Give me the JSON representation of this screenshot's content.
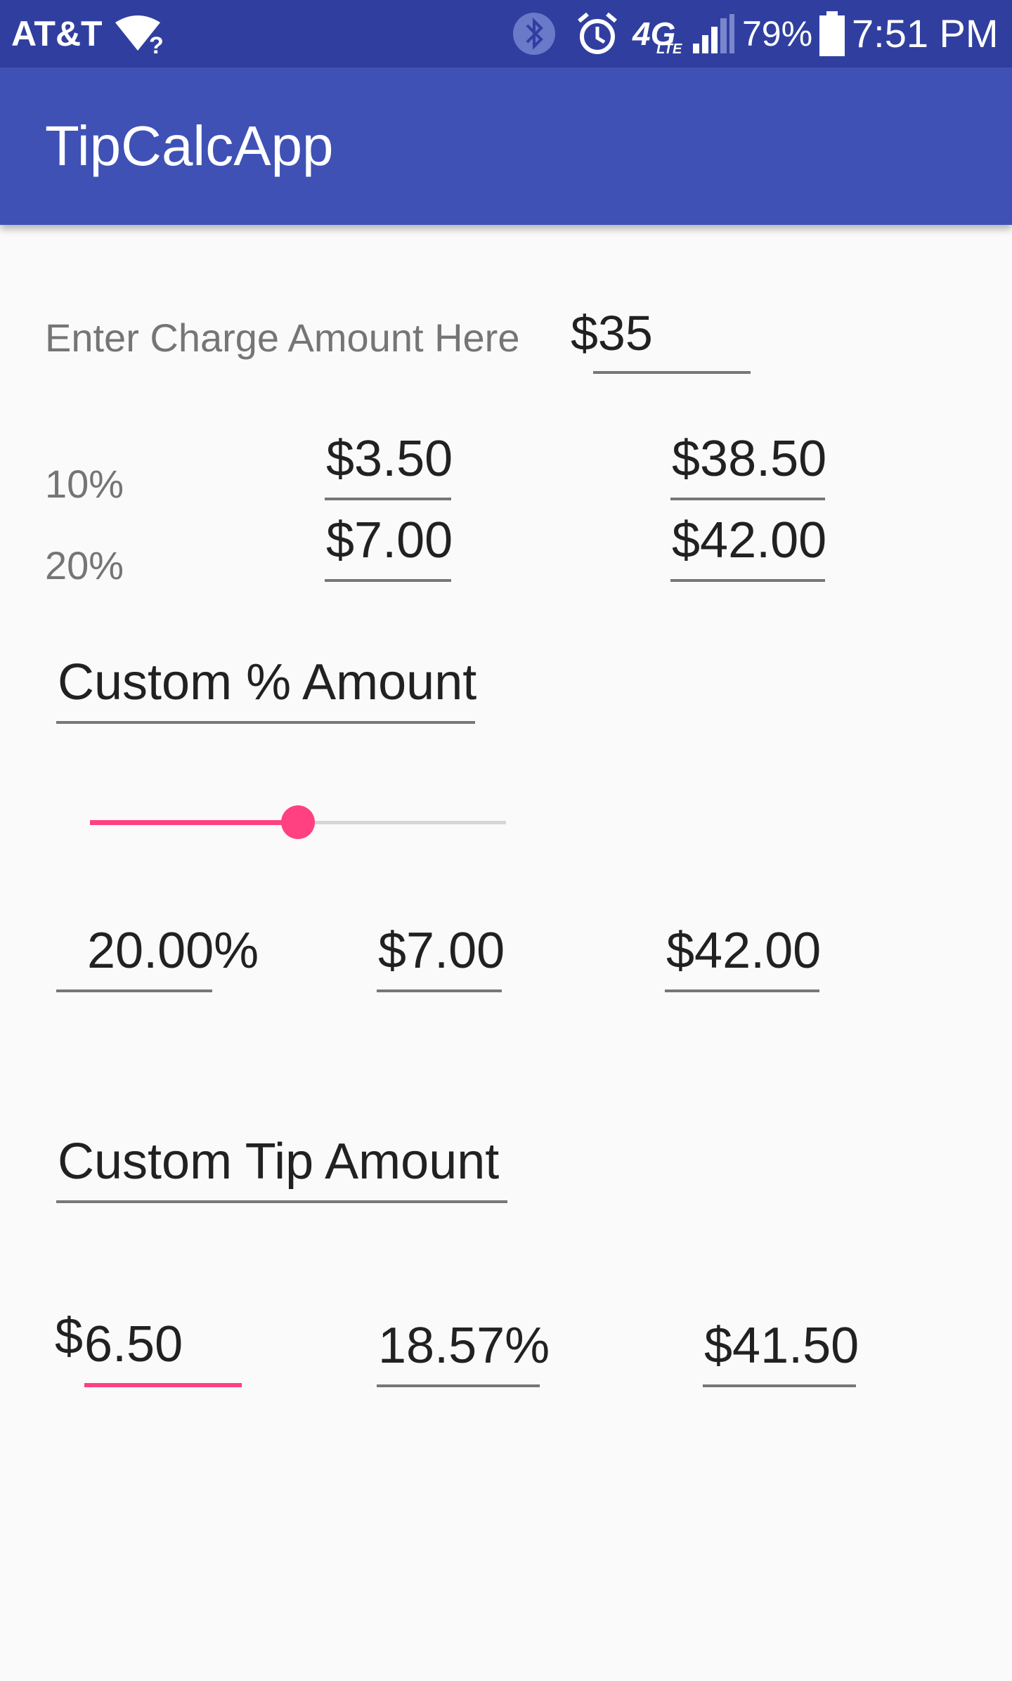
{
  "status_bar": {
    "carrier": "AT&T",
    "battery": "79%",
    "time": "7:51 PM",
    "network": "4G",
    "network_sub": "LTE",
    "icons": [
      "wifi-question-icon",
      "bluetooth-icon",
      "alarm-icon",
      "signal-icon",
      "battery-icon"
    ]
  },
  "app_bar": {
    "title": "TipCalcApp"
  },
  "charge": {
    "label": "Enter Charge Amount Here",
    "value": "$35"
  },
  "fixed_tips": [
    {
      "percent": "10%",
      "tip": "$3.50",
      "total": "$38.50"
    },
    {
      "percent": "20%",
      "tip": "$7.00",
      "total": "$42.00"
    }
  ],
  "custom_percent": {
    "heading": "Custom % Amount",
    "slider_fraction": 0.5,
    "percent": "20.00%",
    "tip": "$7.00",
    "total": "$42.00"
  },
  "custom_tip": {
    "heading": "Custom Tip Amount",
    "currency_symbol": "$",
    "tip_value": "6.50",
    "percent": "18.57%",
    "total": "$41.50"
  },
  "colors": {
    "status_bar": "#303f9f",
    "app_bar": "#3f51b5",
    "accent": "#ff4081",
    "background": "#fafafa"
  }
}
